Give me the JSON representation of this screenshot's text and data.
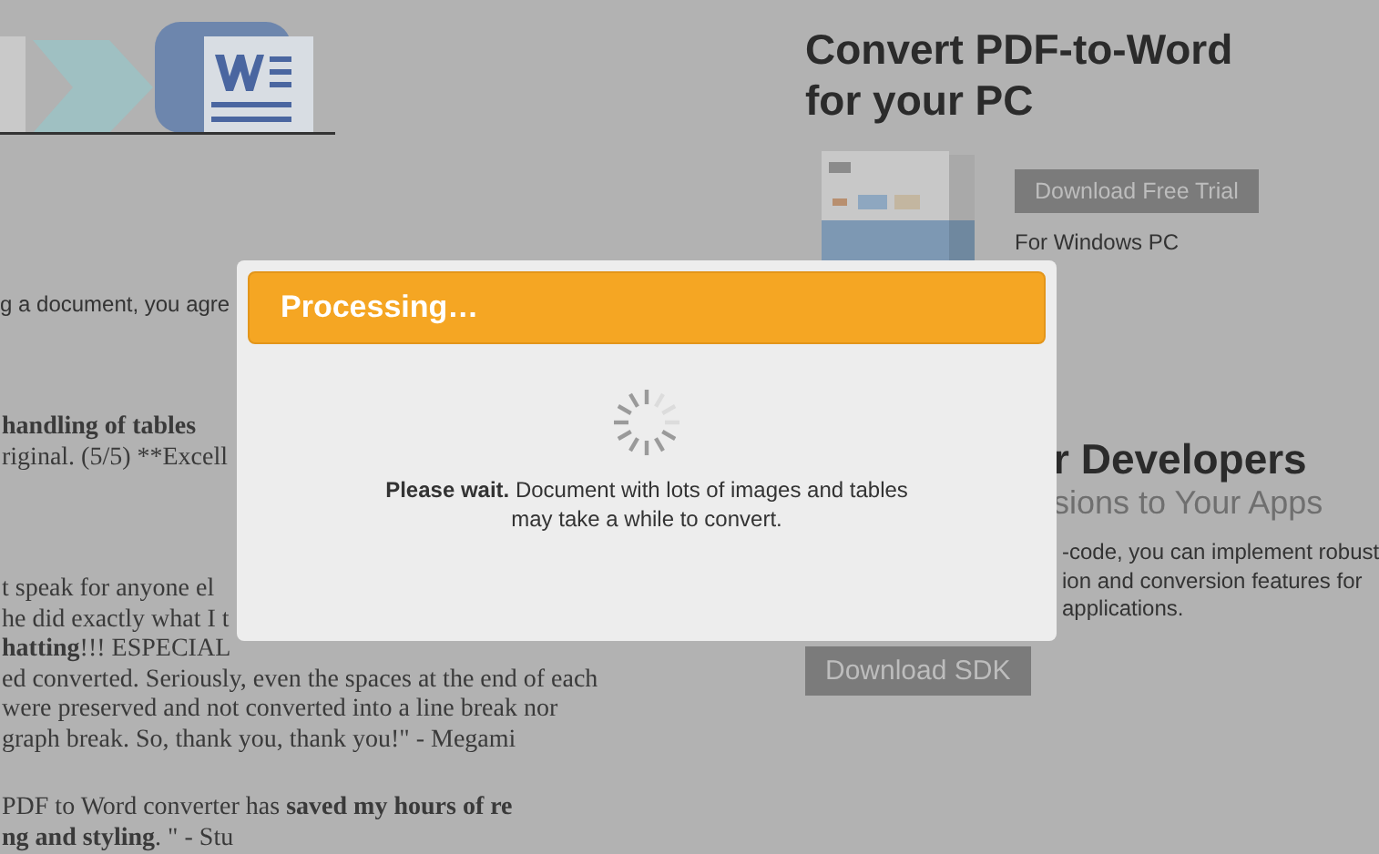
{
  "notice": "g a document, you agre",
  "testimonials": [
    {
      "lines": [
        "**handling of tables**",
        "riginal. (5/5) **Excell"
      ]
    },
    {
      "lines": [
        "t speak for anyone el",
        "he did exactly what I t",
        "**hatting**!!! ESPECIAL",
        "ed converted. Seriously, even the spaces at the end of each",
        "were preserved and not converted into a line break nor",
        "graph break. So, thank you, thank you!\" - Megami"
      ]
    },
    {
      "lines": [
        "PDF to Word converter has **saved my hours of re**",
        "**ng and styling**. \" - Stu"
      ]
    }
  ],
  "desktop": {
    "heading": [
      "Convert PDF-to-Word",
      "for your PC"
    ],
    "product_image": {
      "kind": "picture"
    },
    "button": "Download Free Trial",
    "note": "For Windows PC"
  },
  "developers": {
    "heading": "r Developers",
    "subheading": "sions to Your Apps",
    "description": [
      "-code, you can implement robust",
      "ion and conversion features for",
      "applications."
    ],
    "button": "Download SDK"
  },
  "dialog": {
    "title": "Processing…",
    "message": "**Please wait.** Document with lots of images and tables may take a while to convert."
  }
}
